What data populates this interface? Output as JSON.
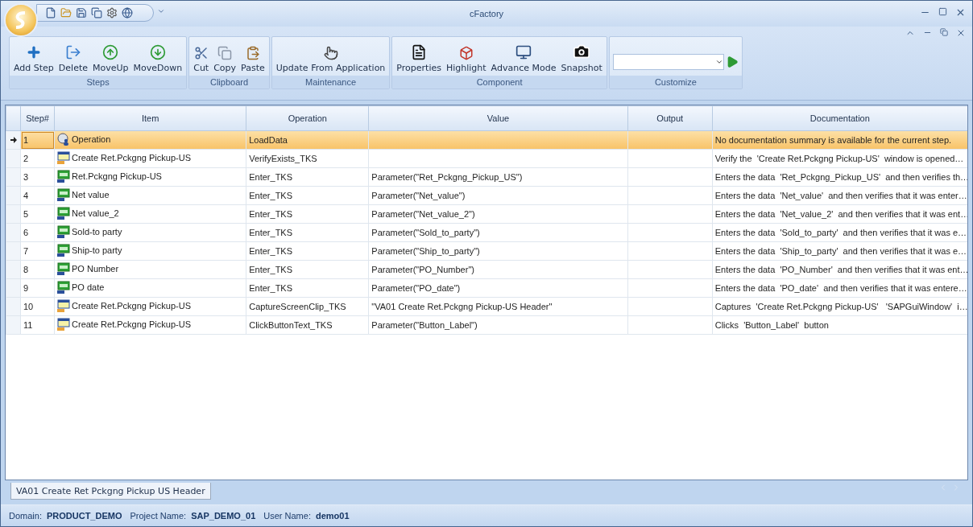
{
  "window": {
    "title": "cFactory"
  },
  "ribbon": {
    "groups": [
      {
        "label": "Steps",
        "kind": "buttons",
        "buttons": [
          "Add Step",
          "Delete",
          "MoveUp",
          "MoveDown"
        ]
      },
      {
        "label": "Clipboard",
        "kind": "buttons",
        "buttons": [
          "Cut",
          "Copy",
          "Paste"
        ]
      },
      {
        "label": "Maintenance",
        "kind": "buttons",
        "buttons": [
          "Update From Application"
        ]
      },
      {
        "label": "Component",
        "kind": "buttons",
        "buttons": [
          "Properties",
          "Highlight",
          "Advance Mode",
          "Snapshot"
        ]
      },
      {
        "label": "Customize",
        "kind": "combo"
      }
    ]
  },
  "table": {
    "columns": [
      "Step#",
      "Item",
      "Operation",
      "Value",
      "Output",
      "Documentation"
    ],
    "rows": [
      {
        "step": "1",
        "kind": "operation",
        "item": "Operation",
        "operation": "LoadData",
        "documentation": "No documentation summary is available for the current step.",
        "selected": true
      },
      {
        "step": "2",
        "kind": "window",
        "item": "Create Ret.Pckgng Pickup-US",
        "operation": "VerifyExists_TKS",
        "documentation": "Verify the  'Create Ret.Pckgng Pickup-US'  window is opened…",
        "selected": false
      },
      {
        "step": "3",
        "kind": "field",
        "item": "Ret.Pckgng Pickup-US",
        "operation": "Enter_TKS",
        "value": "Parameter(\"Ret_Pckgng_Pickup_US\")",
        "documentation": "Enters the data  'Ret_Pckgng_Pickup_US'  and then verifies th…",
        "selected": false
      },
      {
        "step": "4",
        "kind": "field",
        "item": "Net value",
        "operation": "Enter_TKS",
        "value": "Parameter(\"Net_value\")",
        "documentation": "Enters the data  'Net_value'  and then verifies that it was enter…",
        "selected": false
      },
      {
        "step": "5",
        "kind": "field",
        "item": "Net value_2",
        "operation": "Enter_TKS",
        "value": "Parameter(\"Net_value_2\")",
        "documentation": "Enters the data  'Net_value_2'  and then verifies that it was ent…",
        "selected": false
      },
      {
        "step": "6",
        "kind": "field",
        "item": "Sold-to party",
        "operation": "Enter_TKS",
        "value": "Parameter(\"Sold_to_party\")",
        "documentation": "Enters the data  'Sold_to_party'  and then verifies that it was e…",
        "selected": false
      },
      {
        "step": "7",
        "kind": "field",
        "item": "Ship-to party",
        "operation": "Enter_TKS",
        "value": "Parameter(\"Ship_to_party\")",
        "documentation": "Enters the data  'Ship_to_party'  and then verifies that it was e…",
        "selected": false
      },
      {
        "step": "8",
        "kind": "field",
        "item": "PO Number",
        "operation": "Enter_TKS",
        "value": "Parameter(\"PO_Number\")",
        "documentation": "Enters the data  'PO_Number'  and then verifies that it was ent…",
        "selected": false
      },
      {
        "step": "9",
        "kind": "field",
        "item": "PO date",
        "operation": "Enter_TKS",
        "value": "Parameter(\"PO_date\")",
        "documentation": "Enters the data  'PO_date'  and then verifies that it was entere…",
        "selected": false
      },
      {
        "step": "10",
        "kind": "window",
        "item": "Create Ret.Pckgng Pickup-US",
        "operation": "CaptureScreenClip_TKS",
        "value": "\"VA01 Create Ret.Pckgng Pickup-US Header\"",
        "documentation": "Captures  'Create Ret.Pckgng Pickup-US'   'SAPGuiWindow'  i…",
        "selected": false
      },
      {
        "step": "11",
        "kind": "window",
        "item": "Create Ret.Pckgng Pickup-US",
        "operation": "ClickButtonText_TKS",
        "value": "Parameter(\"Button_Label\")",
        "documentation": "Clicks  'Button_Label'  button",
        "selected": false
      }
    ]
  },
  "tabs": [
    {
      "label": "VA01 Create Ret Pckgng Pickup US Header",
      "selected": true
    }
  ],
  "status_bar": [
    {
      "label": "Domain:",
      "value": "PRODUCT_DEMO"
    },
    {
      "label": "Project Name:",
      "value": "SAP_DEMO_01"
    },
    {
      "label": "User Name:",
      "value": "demo01"
    }
  ]
}
